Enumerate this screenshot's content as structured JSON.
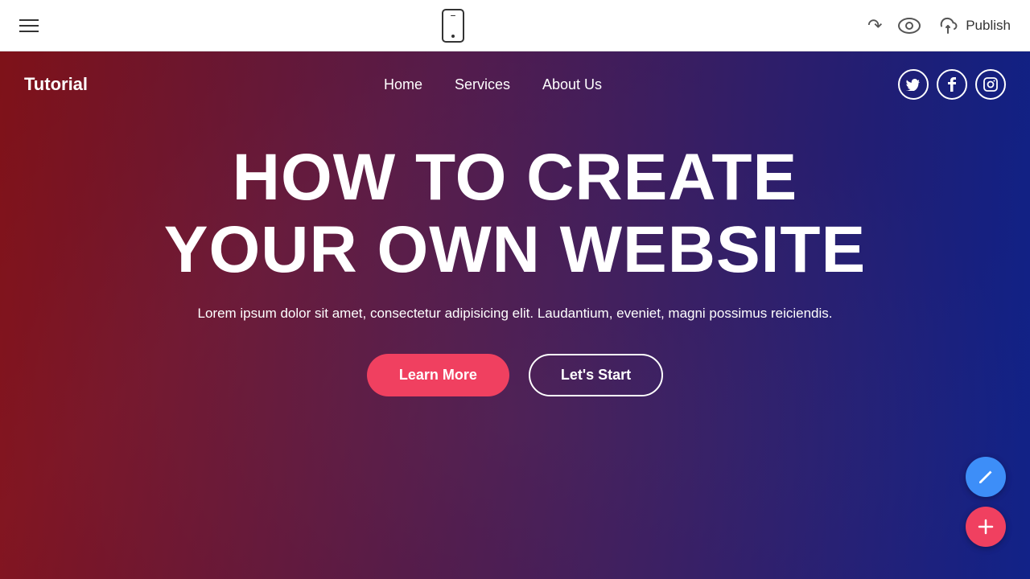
{
  "toolbar": {
    "hamburger_label": "menu",
    "phone_label": "mobile preview",
    "undo_label": "undo",
    "preview_label": "preview",
    "publish_label": "Publish"
  },
  "site": {
    "logo": "Tutorial",
    "nav": {
      "links": [
        {
          "label": "Home",
          "id": "home"
        },
        {
          "label": "Services",
          "id": "services"
        },
        {
          "label": "About Us",
          "id": "about-us"
        }
      ],
      "social": [
        {
          "label": "Twitter",
          "icon": "𝕏",
          "id": "twitter"
        },
        {
          "label": "Facebook",
          "icon": "f",
          "id": "facebook"
        },
        {
          "label": "Instagram",
          "icon": "📷",
          "id": "instagram"
        }
      ]
    },
    "hero": {
      "title_line1": "HOW TO CREATE",
      "title_line2": "YOUR OWN WEBSITE",
      "subtitle": "Lorem ipsum dolor sit amet, consectetur adipisicing elit. Laudantium, eveniet, magni possimus reiciendis.",
      "btn_primary": "Learn More",
      "btn_secondary": "Let's Start"
    }
  },
  "fab": {
    "pencil_label": "edit",
    "plus_label": "add"
  }
}
